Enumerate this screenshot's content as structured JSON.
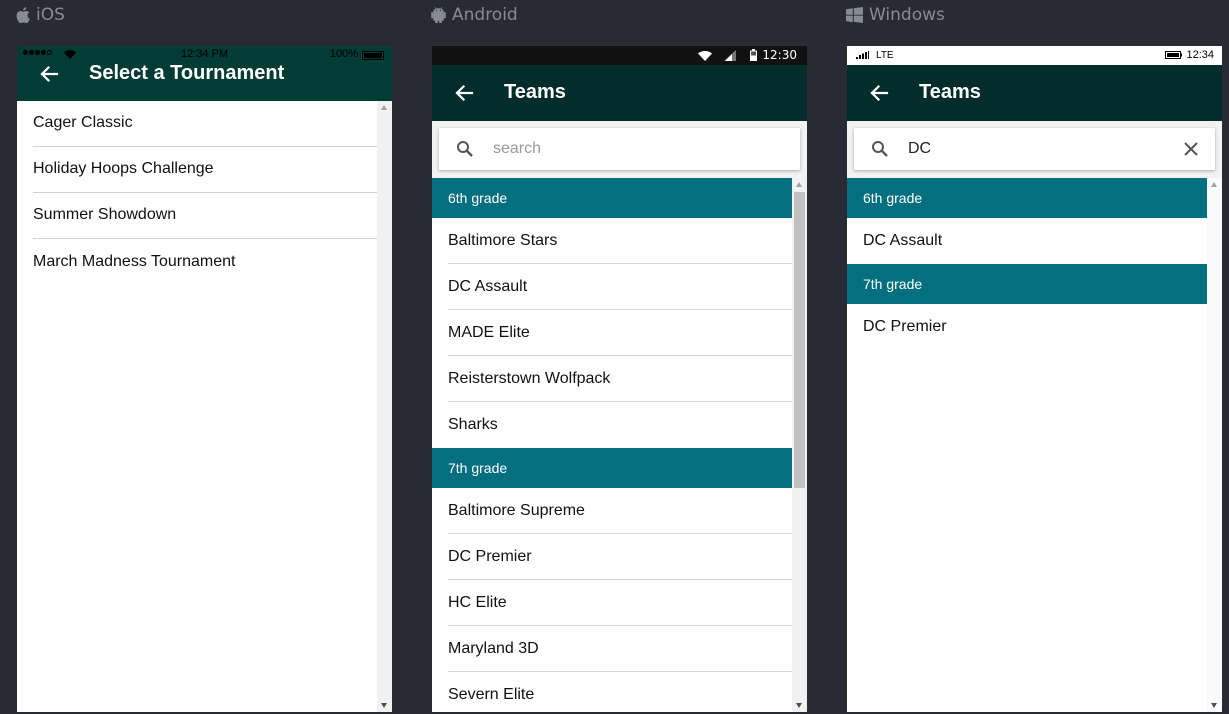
{
  "platforms": {
    "ios": "iOS",
    "android": "Android",
    "windows": "Windows"
  },
  "ios": {
    "status": {
      "time": "12:34 PM",
      "battery": "100%"
    },
    "title": "Select a Tournament",
    "items": [
      "Cager Classic",
      "Holiday Hoops Challenge",
      "Summer Showdown",
      "March Madness Tournament"
    ]
  },
  "android": {
    "status": {
      "time": "12:30"
    },
    "title": "Teams",
    "search": {
      "placeholder": "search",
      "value": ""
    },
    "groups": [
      {
        "grade": "6th grade",
        "teams": [
          "Baltimore Stars",
          "DC Assault",
          "MADE Elite",
          "Reisterstown Wolfpack",
          "Sharks"
        ]
      },
      {
        "grade": "7th grade",
        "teams": [
          "Baltimore Supreme",
          "DC Premier",
          "HC Elite",
          "Maryland 3D",
          "Severn Elite"
        ]
      }
    ]
  },
  "windows": {
    "status": {
      "network": "LTE",
      "time": "12:34"
    },
    "title": "Teams",
    "search": {
      "value": "DC"
    },
    "groups": [
      {
        "grade": "6th grade",
        "teams": [
          "DC Assault"
        ]
      },
      {
        "grade": "7th grade",
        "teams": [
          "DC Premier"
        ]
      }
    ]
  },
  "colors": {
    "background": "#282b33",
    "header": "#033b35",
    "grade_header": "#046f7f"
  }
}
